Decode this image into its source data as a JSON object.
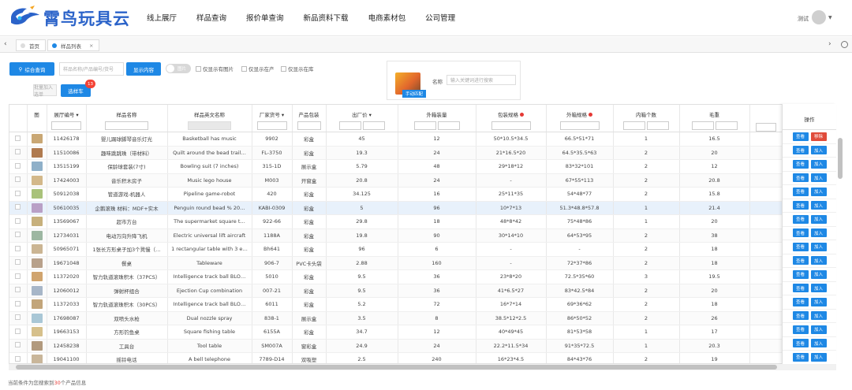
{
  "brand": {
    "name": "霄鸟玩具云"
  },
  "nav": [
    "线上展厅",
    "样品查询",
    "报价单查询",
    "新品资料下载",
    "电商素材包",
    "公司管理"
  ],
  "user": {
    "name": "测试"
  },
  "tabs": [
    {
      "label": "首页",
      "active": false
    },
    {
      "label": "样品列表",
      "active": true
    }
  ],
  "filters": {
    "combined_search": "综合查询",
    "keyword_placeholder": "样品名称/产品编号/货号",
    "show_content": "显示内容",
    "toggle_label": "图片",
    "check_has_image": "仅显示有图片",
    "check_in_production": "仅显示在产",
    "check_in_stock": "仅显示在库",
    "add_selected": "批量加入选单",
    "selection_cart": "选样车",
    "cart_count": "13"
  },
  "promo": {
    "tag": "手动匹配",
    "name_label": "名称",
    "name_placeholder": "输入关键词进行搜索"
  },
  "table": {
    "headers": [
      "图",
      "展厅编号",
      "样品名称",
      "样品英文名称",
      "厂家货号",
      "产品包装",
      "出厂价",
      "外箱装量",
      "包装规格",
      "外箱规格",
      "内箱个数",
      "毛重"
    ],
    "ops_header": "操作",
    "op_view": "查看",
    "op_add": "加入",
    "op_remove": "移除",
    "rows": [
      [
        "11426178",
        "婴儿踢球脚琴音乐灯光",
        "Basketball has music",
        "9902",
        "彩盒",
        "45",
        "12",
        "50*10.5*34.5",
        "66.5*51*71",
        "1",
        "16.5"
      ],
      [
        "11510086",
        "趣味跳跳珠（带材料）",
        "Quilt around the bead trail…",
        "FL-3750",
        "彩盒",
        "19.3",
        "24",
        "21*16.5*20",
        "64.5*35.5*63",
        "2",
        "20"
      ],
      [
        "13515199",
        "保龄球套装(7寸)",
        "Bowling suit (7 inches)",
        "315-1D",
        "展示盒",
        "5.79",
        "48",
        "29*18*12",
        "83*32*101",
        "2",
        "12"
      ],
      [
        "17424003",
        "音乐积木房子",
        "Music lego house",
        "M003",
        "开窗盒",
        "20.8",
        "24",
        "-",
        "67*55*113",
        "2",
        "20.8"
      ],
      [
        "50912038",
        "管道游戏-机器人",
        "Pipeline game-robot",
        "420",
        "彩盒",
        "34.125",
        "16",
        "25*11*35",
        "54*48*77",
        "2",
        "15.8"
      ],
      [
        "50610035",
        "企鹅滚珠 材料：MDF+实木",
        "Penguin round bead % 20…",
        "KABI-0309",
        "彩盒",
        "5",
        "96",
        "10*7*13",
        "51.3*48.8*57.8",
        "1",
        "21.4"
      ],
      [
        "13569067",
        "超市方台",
        "The supermarket square t…",
        "922-66",
        "彩盒",
        "29.8",
        "18",
        "48*8*42",
        "75*48*86",
        "1",
        "20"
      ],
      [
        "12734031",
        "电动万向升降飞机",
        "Electric universal lift aircraft",
        "1188A",
        "彩盒",
        "19.8",
        "90",
        "30*14*10",
        "64*53*95",
        "2",
        "38"
      ],
      [
        "50965071",
        "1张长方形桌子加3个凳慢（…",
        "1 rectangular table with 3 e…",
        "Bh641",
        "彩盒",
        "96",
        "6",
        "-",
        "-",
        "2",
        "18"
      ],
      [
        "19671048",
        "餐桌",
        "Tableware",
        "906-7",
        "PVC卡头袋",
        "2.88",
        "160",
        "-",
        "72*37*86",
        "2",
        "18"
      ],
      [
        "11372020",
        "智力轨道滚珠积木（37PCS）",
        "Intelligence track ball BLO…",
        "5010",
        "彩盒",
        "9.5",
        "36",
        "23*8*20",
        "72.5*35*60",
        "3",
        "19.5"
      ],
      [
        "12060012",
        "弹射杯组合",
        "Ejection Cup combination",
        "007-21",
        "彩盒",
        "9.5",
        "36",
        "41*6.5*27",
        "83*42.5*84",
        "2",
        "20"
      ],
      [
        "11372033",
        "智力轨道滚珠积木（30PCS）",
        "Intelligence track ball BLO…",
        "6011",
        "彩盒",
        "5.2",
        "72",
        "16*7*14",
        "69*36*62",
        "2",
        "18"
      ],
      [
        "17698087",
        "双喷头水枪",
        "Dual nozzle spray",
        "838-1",
        "展示盒",
        "3.5",
        "8",
        "38.5*12*2.5",
        "86*50*52",
        "2",
        "26"
      ],
      [
        "19663153",
        "方形钓鱼桌",
        "Square fishing table",
        "6155A",
        "彩盒",
        "34.7",
        "12",
        "40*49*45",
        "81*53*58",
        "1",
        "17"
      ],
      [
        "12458238",
        "工具台",
        "Tool table",
        "SM007A",
        "窗彩盒",
        "24.9",
        "24",
        "22.2*11.5*34",
        "91*35*72.5",
        "1",
        "20.3"
      ],
      [
        "19041100",
        "摇铃电话",
        "A bell telephone",
        "7789-D14",
        "双吸塑",
        "2.5",
        "240",
        "16*23*4.5",
        "84*43*76",
        "2",
        "19"
      ]
    ]
  },
  "footer": {
    "prefix": "当前条件为您搜索到",
    "count": "30",
    "suffix": "个产品信息"
  },
  "colors": {
    "primary": "#1e88e5",
    "brand": "#2b63c9",
    "danger": "#e04b3a"
  }
}
